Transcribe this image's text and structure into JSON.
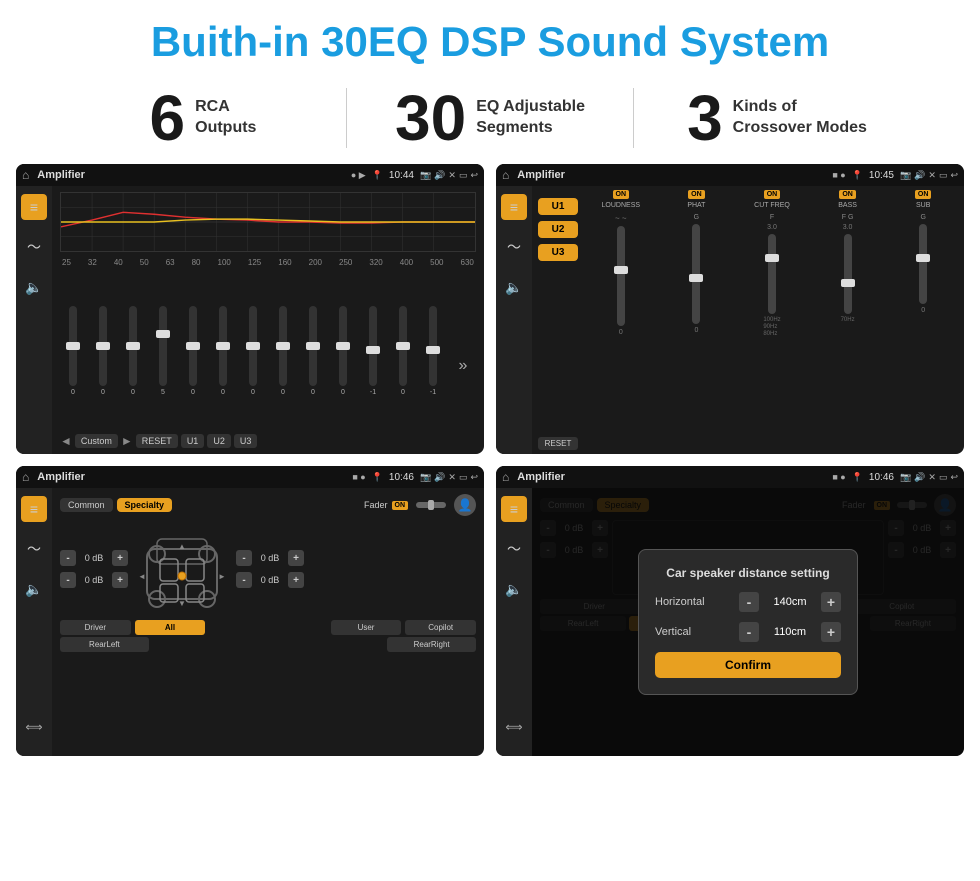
{
  "header": {
    "title": "Buith-in 30EQ DSP Sound System"
  },
  "stats": [
    {
      "number": "6",
      "text_line1": "RCA",
      "text_line2": "Outputs"
    },
    {
      "number": "30",
      "text_line1": "EQ Adjustable",
      "text_line2": "Segments"
    },
    {
      "number": "3",
      "text_line1": "Kinds of",
      "text_line2": "Crossover Modes"
    }
  ],
  "screen1": {
    "app_name": "Amplifier",
    "time": "10:44",
    "eq_labels": [
      "25",
      "32",
      "40",
      "50",
      "63",
      "80",
      "100",
      "125",
      "160",
      "200",
      "250",
      "320",
      "400",
      "500",
      "630"
    ],
    "eq_values": [
      "0",
      "0",
      "0",
      "5",
      "0",
      "0",
      "0",
      "0",
      "0",
      "0",
      "-1",
      "0",
      "-1"
    ],
    "buttons": [
      "Custom",
      "RESET",
      "U1",
      "U2",
      "U3"
    ]
  },
  "screen2": {
    "app_name": "Amplifier",
    "time": "10:45",
    "presets": [
      "U1",
      "U2",
      "U3"
    ],
    "controls": [
      "LOUDNESS",
      "PHAT",
      "CUT FREQ",
      "BASS",
      "SUB"
    ],
    "toggles": [
      "ON",
      "ON",
      "ON",
      "ON",
      "ON"
    ],
    "reset_label": "RESET"
  },
  "screen3": {
    "app_name": "Amplifier",
    "time": "10:46",
    "tabs": [
      "Common",
      "Specialty"
    ],
    "fader_label": "Fader",
    "fader_toggle": "ON",
    "db_values": [
      "0 dB",
      "0 dB",
      "0 dB",
      "0 dB"
    ],
    "buttons": [
      "Driver",
      "All",
      "User",
      "Copilot",
      "RearLeft",
      "RearRight"
    ]
  },
  "screen4": {
    "app_name": "Amplifier",
    "time": "10:46",
    "tabs": [
      "Common",
      "Specialty"
    ],
    "dialog": {
      "title": "Car speaker distance setting",
      "horizontal_label": "Horizontal",
      "horizontal_value": "140cm",
      "vertical_label": "Vertical",
      "vertical_value": "110cm",
      "confirm_label": "Confirm"
    },
    "db_values": [
      "0 dB",
      "0 dB"
    ],
    "buttons": [
      "Driver",
      "Copilot",
      "RearLeft",
      "RearRight"
    ]
  }
}
